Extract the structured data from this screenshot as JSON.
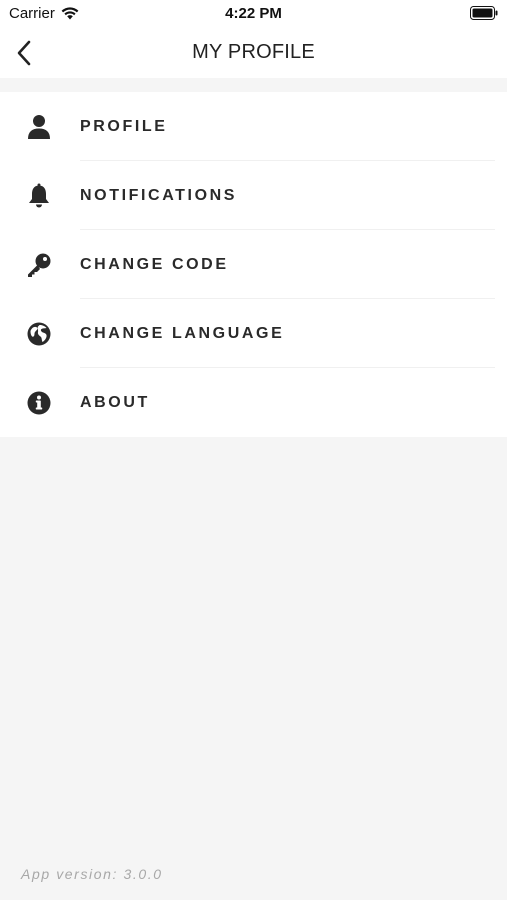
{
  "status_bar": {
    "carrier": "Carrier",
    "time": "4:22 PM",
    "icons": [
      "wifi-icon",
      "battery-icon"
    ]
  },
  "header": {
    "title": "MY PROFILE",
    "back_icon": "chevron-left-icon"
  },
  "menu": {
    "items": [
      {
        "label": "PROFILE",
        "icon": "user-icon"
      },
      {
        "label": "NOTIFICATIONS",
        "icon": "bell-icon"
      },
      {
        "label": "CHANGE CODE",
        "icon": "key-icon"
      },
      {
        "label": "CHANGE LANGUAGE",
        "icon": "globe-icon"
      },
      {
        "label": "ABOUT",
        "icon": "info-icon"
      }
    ]
  },
  "footer": {
    "version_text": "App version: 3.0.0"
  },
  "colors": {
    "background": "#f5f5f5",
    "surface": "#ffffff",
    "text": "#2a2a2a",
    "muted": "#a8a8a8"
  }
}
